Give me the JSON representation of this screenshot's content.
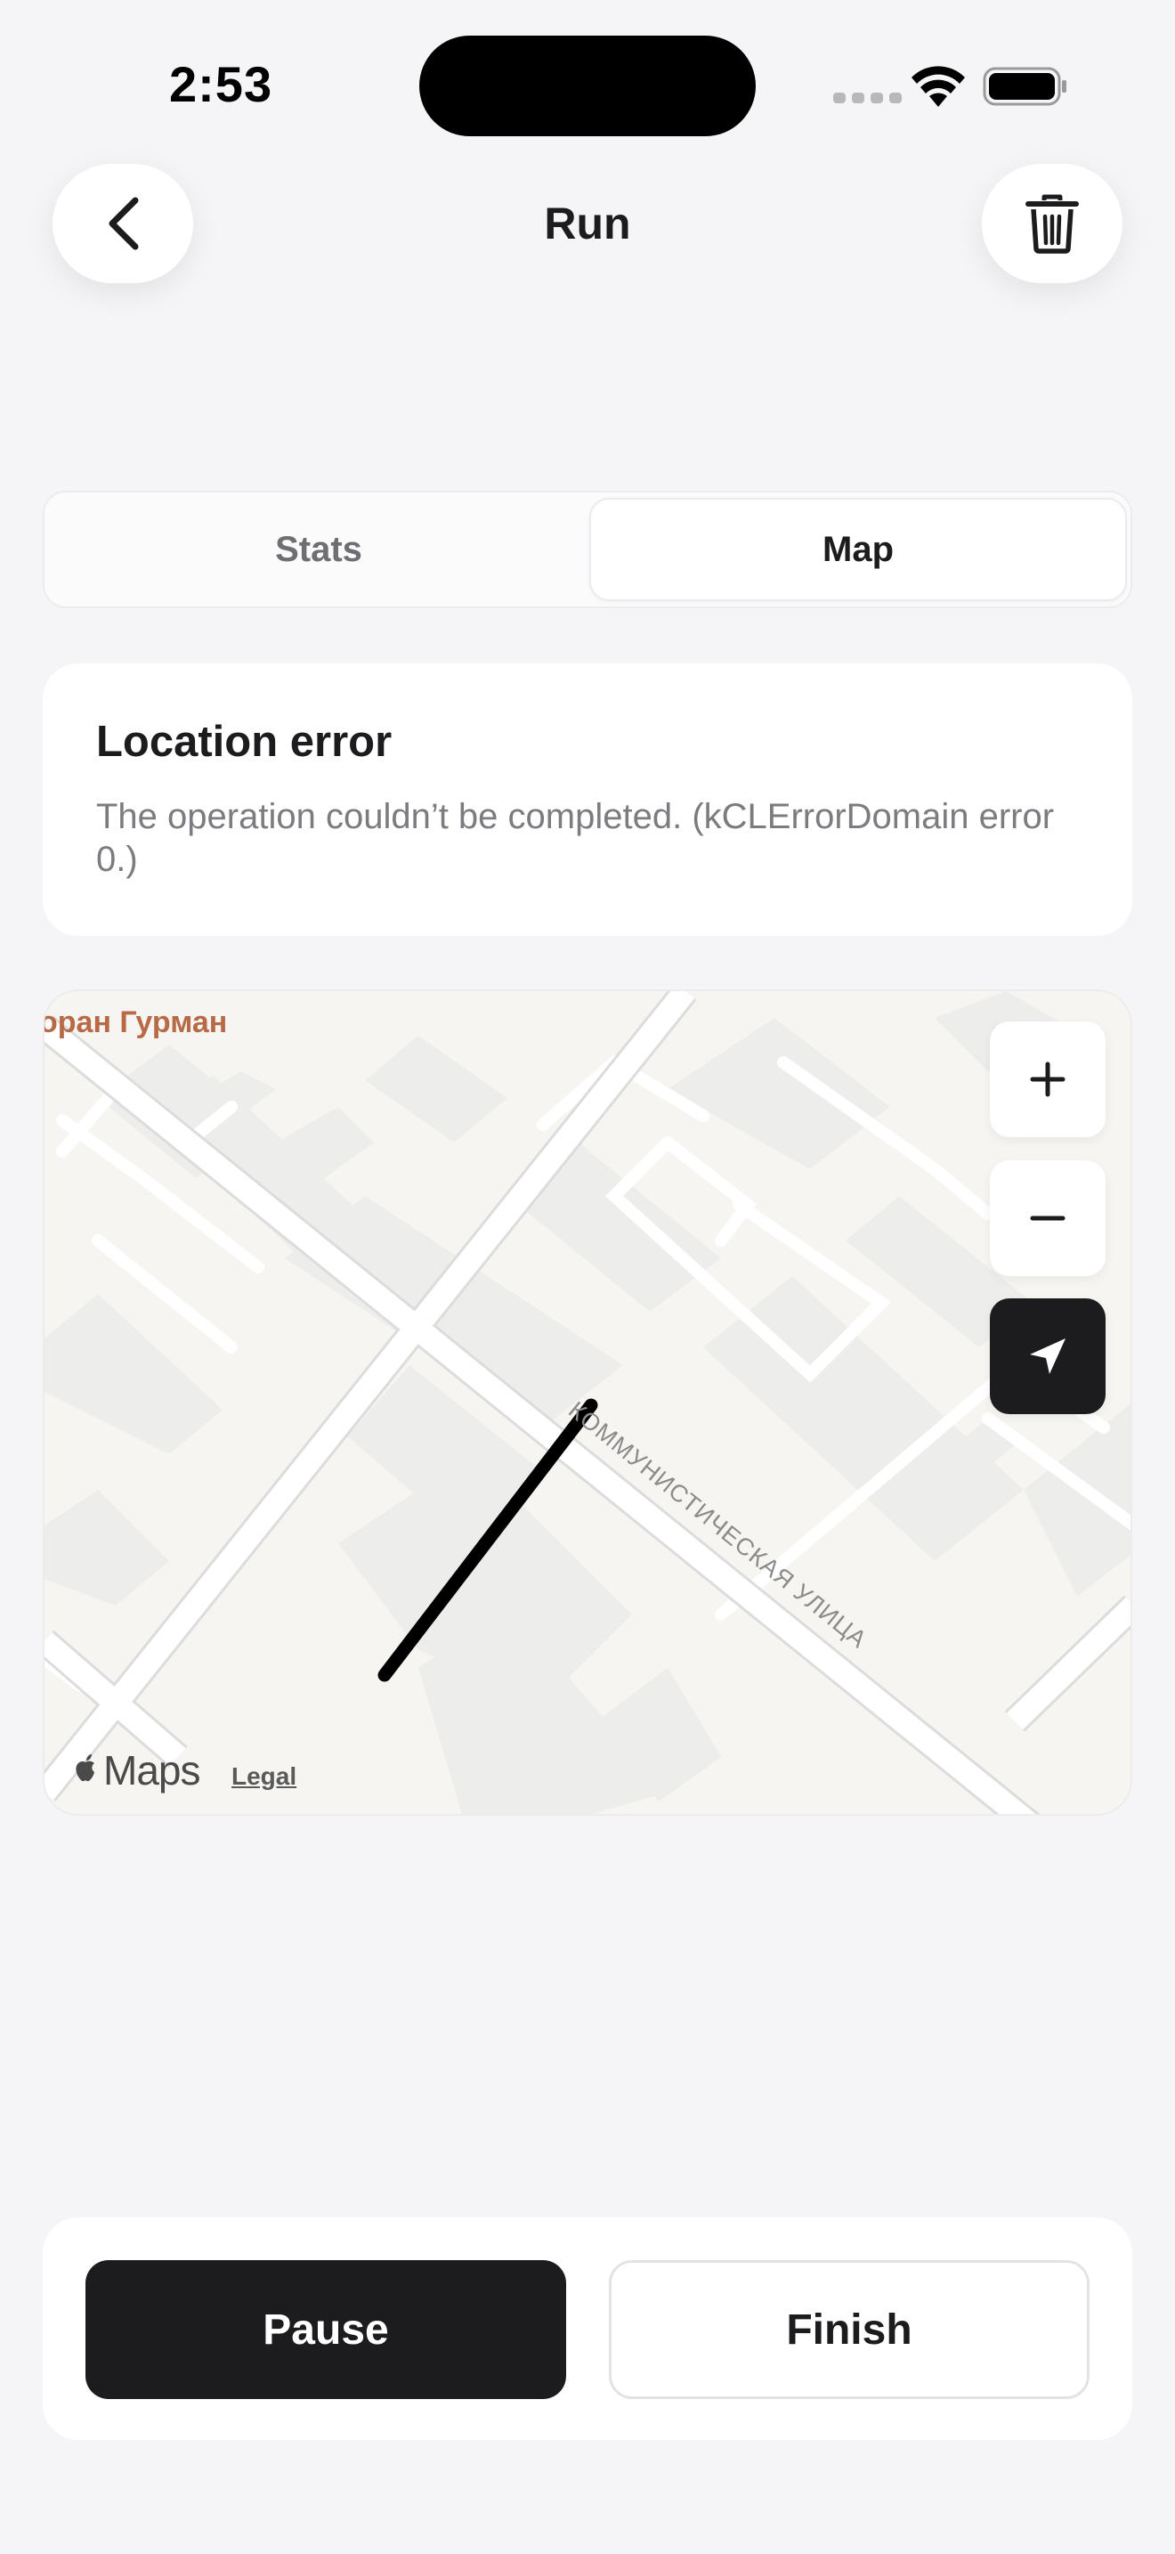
{
  "status_bar": {
    "time": "2:53",
    "icons": [
      "cellular-signal-icon",
      "wifi-icon",
      "battery-icon"
    ]
  },
  "header": {
    "title": "Run",
    "back_icon": "chevron-left-icon",
    "trash_icon": "trash-icon"
  },
  "tabs": [
    {
      "label": "Stats",
      "selected": false
    },
    {
      "label": "Map",
      "selected": true
    }
  ],
  "error": {
    "title": "Location error",
    "message": "The operation couldn’t be completed. (kCLErrorDomain error 0.)"
  },
  "map": {
    "poi_label": "оран Гурман",
    "street_label": "КОММУНИСТИЧЕСКАЯ УЛИЦА",
    "controls": {
      "zoom_in_icon": "plus-icon",
      "zoom_out_icon": "minus-icon",
      "locate_icon": "location-arrow-icon"
    },
    "attribution": {
      "brand": "Maps",
      "logo_icon": "apple-logo-icon",
      "legal": "Legal"
    },
    "route_color": "#000000"
  },
  "actions": {
    "pause_label": "Pause",
    "finish_label": "Finish"
  },
  "colors": {
    "background": "#f5f5f7",
    "primary": "#1c1c1e",
    "card": "#ffffff",
    "poi": "#b76a45"
  }
}
